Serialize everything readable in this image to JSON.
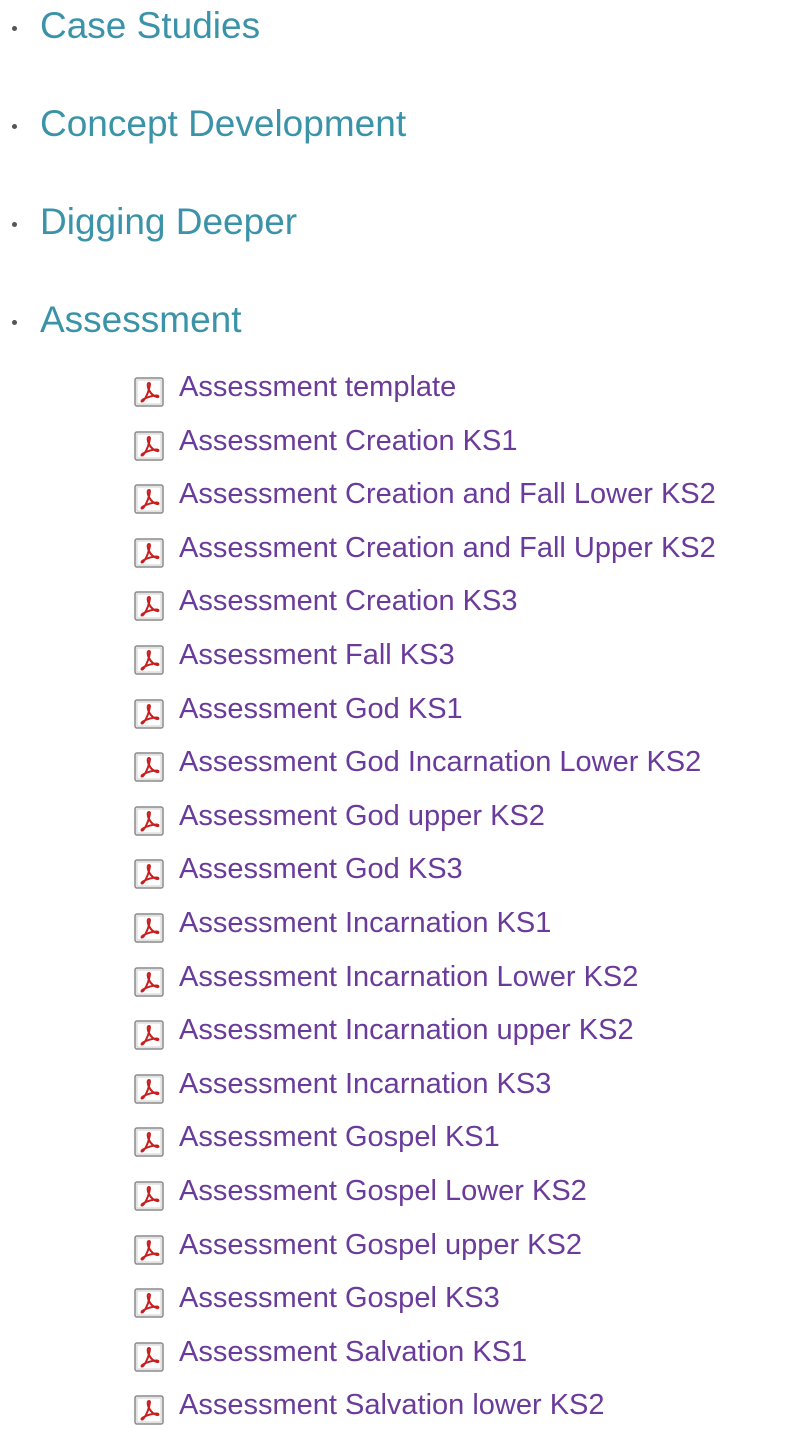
{
  "colors": {
    "section_link": "#3a93a8",
    "file_link": "#6a3b9a",
    "pdf_icon_red": "#c81e1e"
  },
  "sections": [
    {
      "label": "Case Studies"
    },
    {
      "label": "Concept Development"
    },
    {
      "label": "Digging Deeper"
    },
    {
      "label": "Assessment"
    }
  ],
  "files": [
    {
      "label": "Assessment template",
      "icon": "pdf-icon"
    },
    {
      "label": "Assessment Creation KS1",
      "icon": "pdf-icon"
    },
    {
      "label": "Assessment Creation and Fall Lower KS2",
      "icon": "pdf-icon"
    },
    {
      "label": "Assessment Creation and Fall Upper KS2",
      "icon": "pdf-icon"
    },
    {
      "label": "Assessment Creation KS3",
      "icon": "pdf-icon"
    },
    {
      "label": "Assessment Fall KS3",
      "icon": "pdf-icon"
    },
    {
      "label": "Assessment God KS1",
      "icon": "pdf-icon"
    },
    {
      "label": "Assessment God Incarnation Lower KS2",
      "icon": "pdf-icon"
    },
    {
      "label": "Assessment God upper KS2",
      "icon": "pdf-icon"
    },
    {
      "label": "Assessment God KS3",
      "icon": "pdf-icon"
    },
    {
      "label": "Assessment Incarnation KS1",
      "icon": "pdf-icon"
    },
    {
      "label": "Assessment Incarnation Lower KS2",
      "icon": "pdf-icon"
    },
    {
      "label": "Assessment Incarnation upper KS2",
      "icon": "pdf-icon"
    },
    {
      "label": "Assessment Incarnation KS3",
      "icon": "pdf-icon"
    },
    {
      "label": "Assessment Gospel KS1",
      "icon": "pdf-icon"
    },
    {
      "label": "Assessment Gospel Lower KS2",
      "icon": "pdf-icon"
    },
    {
      "label": "Assessment Gospel upper KS2",
      "icon": "pdf-icon"
    },
    {
      "label": "Assessment Gospel KS3",
      "icon": "pdf-icon"
    },
    {
      "label": "Assessment Salvation KS1",
      "icon": "pdf-icon"
    },
    {
      "label": "Assessment Salvation lower KS2",
      "icon": "pdf-icon"
    }
  ]
}
